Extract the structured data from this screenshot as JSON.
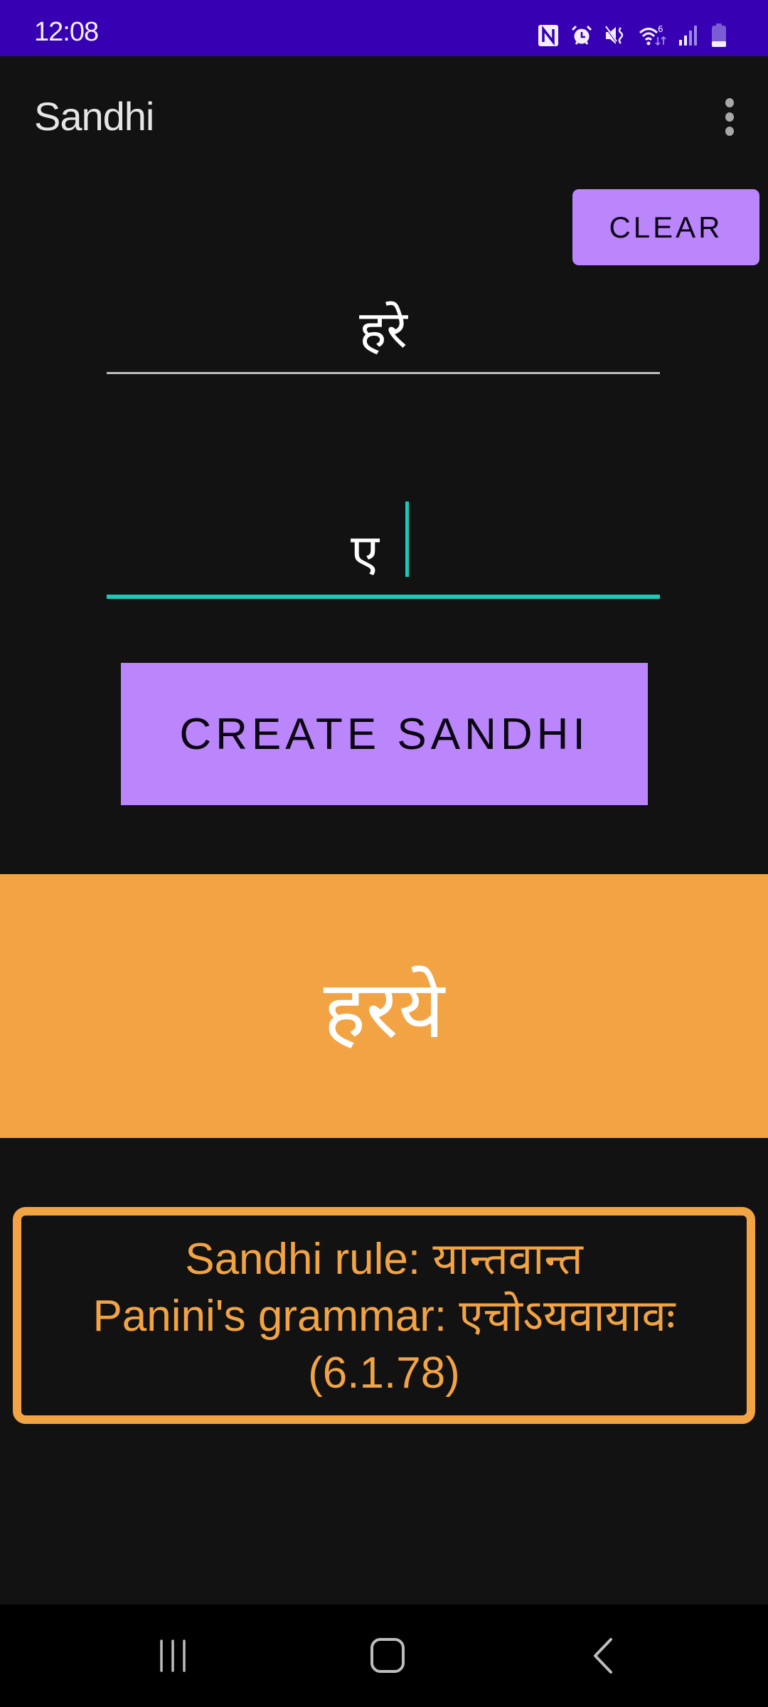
{
  "status_bar": {
    "time": "12:08",
    "icons": [
      "nfc-icon",
      "alarm-icon",
      "mute-icon",
      "wifi-icon",
      "signal-icon",
      "battery-icon"
    ],
    "wifi_label": "6",
    "background": "#3700b3"
  },
  "app_bar": {
    "title": "Sandhi",
    "menu_icon": "more-vert-icon"
  },
  "actions": {
    "clear_label": "CLEAR",
    "create_label": "CREATE SANDHI"
  },
  "inputs": {
    "first_word": "हरे",
    "second_word": "ए"
  },
  "result": {
    "sandhi": "हरये"
  },
  "rule": {
    "sandhi_rule_label": "Sandhi rule: यान्तवान्त",
    "panini_label": "Panini's grammar: एचोऽयवायावः",
    "sutra_number": "(6.1.78)"
  },
  "nav_bar": {
    "buttons": [
      "recents-icon",
      "home-icon",
      "back-icon"
    ]
  },
  "colors": {
    "accent_purple": "#bb86fc",
    "accent_orange": "#f2a444",
    "focus_teal": "#14cbb8",
    "background": "#121212"
  }
}
